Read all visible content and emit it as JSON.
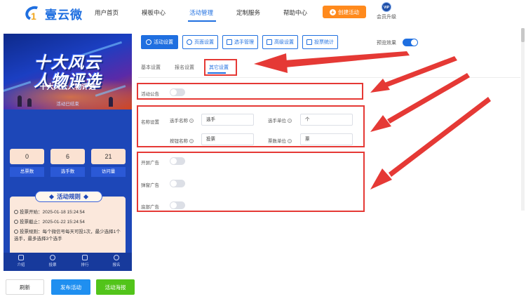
{
  "logo": {
    "num": "1",
    "text": "壹云微"
  },
  "nav": {
    "items": [
      "用户首页",
      "模板中心",
      "活动管理",
      "定制服务",
      "帮助中心"
    ],
    "active_index": 2,
    "create_button": "创建活动",
    "vip_badge": "VIP",
    "vip_label": "会员升级"
  },
  "preview": {
    "banner_line1": "十大风云",
    "banner_line2": "人物评选",
    "event_title": "十大风云人物评选",
    "status": "活动已结束",
    "stats": [
      {
        "value": "0",
        "label": "总票数"
      },
      {
        "value": "6",
        "label": "选手数"
      },
      {
        "value": "21",
        "label": "访问量"
      }
    ],
    "rules_title": "活动规则",
    "rules": [
      "投票开始：2025-01-18 15:24:54",
      "投票截止：2025-01-22 15:24:54",
      "投票规则：每个微信号每天可投1次，最少选择1个选手，最多选择3个选手"
    ],
    "tabs": [
      "介绍",
      "投票",
      "排行",
      "报名"
    ]
  },
  "bottom_buttons": {
    "refresh": "刷新",
    "publish": "发布活动",
    "poster": "活动海报"
  },
  "toolbar": {
    "buttons": [
      "活动设置",
      "页面设置",
      "选手管理",
      "高级设置",
      "投票统计"
    ],
    "active_index": 0,
    "preview_label": "预览效果",
    "preview_on": true
  },
  "subtabs": {
    "items": [
      "基本设置",
      "报名设置",
      "其它设置"
    ],
    "active_index": 2
  },
  "settings": {
    "announcement_label": "活动公告",
    "announcement_on": false,
    "naming_label": "名称设置",
    "player_name_label": "选手名称",
    "player_name_value": "选手",
    "player_unit_label": "选手单位",
    "player_unit_value": "个",
    "button_name_label": "按钮名称",
    "button_name_value": "投票",
    "vote_unit_label": "票数单位",
    "vote_unit_value": "票",
    "open_ad_label": "开屏广告",
    "open_ad_on": false,
    "popup_ad_label": "弹窗广告",
    "popup_ad_on": false,
    "bottom_ad_label": "底部广告",
    "bottom_ad_on": false
  },
  "colors": {
    "primary": "#1f6fe0",
    "orange": "#ff8a1d",
    "green": "#52c41a",
    "annotation_red": "#e53935"
  }
}
